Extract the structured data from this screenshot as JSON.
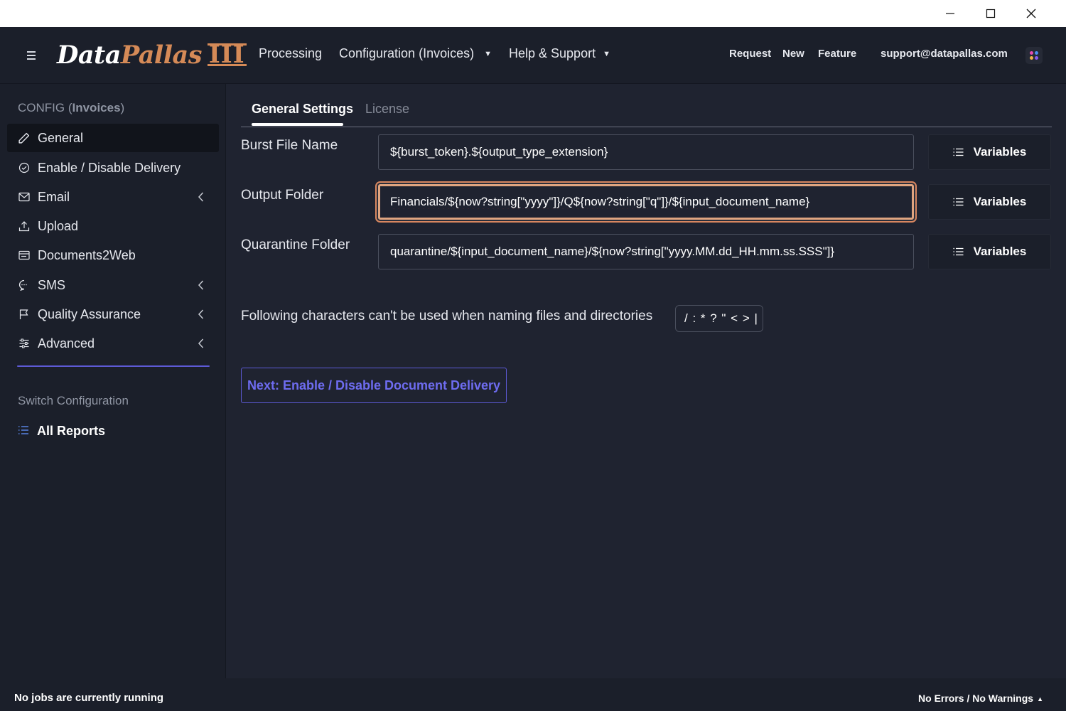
{
  "window": {
    "minimize_icon": "minimize-icon",
    "maximize_icon": "maximize-icon",
    "close_icon": "close-icon"
  },
  "navbar": {
    "logo": {
      "part1": "Data",
      "part2": "Pallas",
      "part3": "III"
    },
    "menu": [
      {
        "label": "Processing"
      },
      {
        "label": "Configuration (Invoices)",
        "has_dropdown": true
      },
      {
        "label": "Help & Support",
        "has_dropdown": true
      }
    ],
    "request": "Request",
    "new": "New",
    "feature": "Feature",
    "support_email": "support@datapallas.com",
    "dropdown_caret": "▼"
  },
  "sidebar": {
    "header_prefix": "CONFIG (",
    "header_name": "Invoices",
    "header_suffix": ")",
    "items": [
      {
        "label": "General",
        "icon": "pencil-icon",
        "active": true
      },
      {
        "label": "Enable / Disable Delivery",
        "icon": "check-circle-icon"
      },
      {
        "label": "Email",
        "icon": "envelope-icon",
        "expandable": true
      },
      {
        "label": "Upload",
        "icon": "upload-icon"
      },
      {
        "label": "Documents2Web",
        "icon": "browser-icon"
      },
      {
        "label": "SMS",
        "icon": "chat-bubble-icon",
        "expandable": true
      },
      {
        "label": "Quality Assurance",
        "icon": "flag-icon",
        "expandable": true
      },
      {
        "label": "Advanced",
        "icon": "sliders-icon",
        "expandable": true
      }
    ],
    "switch_header": "Switch Configuration",
    "all_reports": "All Reports"
  },
  "tabs": [
    {
      "label": "General Settings",
      "active": true
    },
    {
      "label": "License",
      "active": false
    }
  ],
  "fields": {
    "burst_file_name": {
      "label": "Burst File Name",
      "value": "${burst_token}.${output_type_extension}"
    },
    "output_folder": {
      "label": "Output Folder",
      "value": "Financials/${now?string[\"yyyy\"]}/Q${now?string[\"q\"]}/${input_document_name}"
    },
    "quarantine_folder": {
      "label": "Quarantine Folder",
      "value": "quarantine/${input_document_name}/${now?string[\"yyyy.MM.dd_HH.mm.ss.SSS\"]}"
    }
  },
  "variables_button": "Variables",
  "forbidden_note": "Following characters can't be used when naming files and directories",
  "forbidden_chars": "/ : * ? \" < > |",
  "next_button": "Next: Enable / Disable Document Delivery",
  "status": {
    "left": "No jobs are currently running",
    "right": "No Errors / No Warnings",
    "right_caret": "▲"
  },
  "colors": {
    "accent": "#5d5ad6",
    "brand": "#d58a57",
    "background": "#1f2330",
    "panel": "#1b1f2a"
  }
}
